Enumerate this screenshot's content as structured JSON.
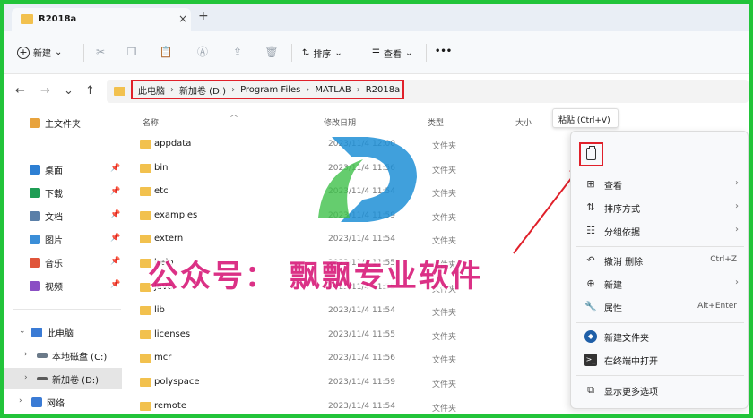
{
  "tab": {
    "title": "R2018a",
    "close": "×",
    "new_tab": "+"
  },
  "toolbar": {
    "new_label": "新建",
    "sort_label": "排序",
    "view_label": "查看",
    "more": "•••",
    "dropdown": "⌄"
  },
  "nav": {
    "back": "←",
    "forward": "→",
    "down": "⌄",
    "up": "↑"
  },
  "breadcrumb": [
    "此电脑",
    "新加卷 (D:)",
    "Program Files",
    "MATLAB",
    "R2018a"
  ],
  "breadcrumb_sep": "›",
  "sidebar": {
    "home": "主文件夹",
    "pinned": [
      "桌面",
      "下载",
      "文档",
      "图片",
      "音乐",
      "视频"
    ],
    "this_pc": "此电脑",
    "drives": [
      "本地磁盘 (C:)",
      "新加卷 (D:)"
    ],
    "network": "网络"
  },
  "columns": {
    "name": "名称",
    "date": "修改日期",
    "type": "类型",
    "size": "大小"
  },
  "files": [
    {
      "name": "appdata",
      "date": "2023/11/4 12:00",
      "type": "文件夹"
    },
    {
      "name": "bin",
      "date": "2023/11/4 11:56",
      "type": "文件夹"
    },
    {
      "name": "etc",
      "date": "2023/11/4 11:54",
      "type": "文件夹"
    },
    {
      "name": "examples",
      "date": "2023/11/4 11:59",
      "type": "文件夹"
    },
    {
      "name": "extern",
      "date": "2023/11/4 11:54",
      "type": "文件夹"
    },
    {
      "name": "help",
      "date": "2023/11/4 11:55",
      "type": "文件夹"
    },
    {
      "name": "java",
      "date": "2023/11/4 11:55",
      "type": "文件夹"
    },
    {
      "name": "lib",
      "date": "2023/11/4 11:54",
      "type": "文件夹"
    },
    {
      "name": "licenses",
      "date": "2023/11/4 11:55",
      "type": "文件夹"
    },
    {
      "name": "mcr",
      "date": "2023/11/4 11:56",
      "type": "文件夹"
    },
    {
      "name": "polyspace",
      "date": "2023/11/4 11:59",
      "type": "文件夹"
    },
    {
      "name": "remote",
      "date": "2023/11/4 11:54",
      "type": "文件夹"
    }
  ],
  "tooltip": "粘贴 (Ctrl+V)",
  "context_menu": {
    "view": "查看",
    "sort_by": "排序方式",
    "group_by": "分组依据",
    "undo_delete": "撤消 删除",
    "undo_shortcut": "Ctrl+Z",
    "new": "新建",
    "properties": "属性",
    "properties_shortcut": "Alt+Enter",
    "new_folder": "新建文件夹",
    "open_terminal": "在终端中打开",
    "more_options": "显示更多选项"
  },
  "watermark": "公众号：  飘飘专业软件",
  "colors": {
    "accent_red": "#e0202a",
    "folder": "#f2c14e",
    "frame_green": "#22c43a",
    "watermark_pink": "#d81b7a"
  }
}
